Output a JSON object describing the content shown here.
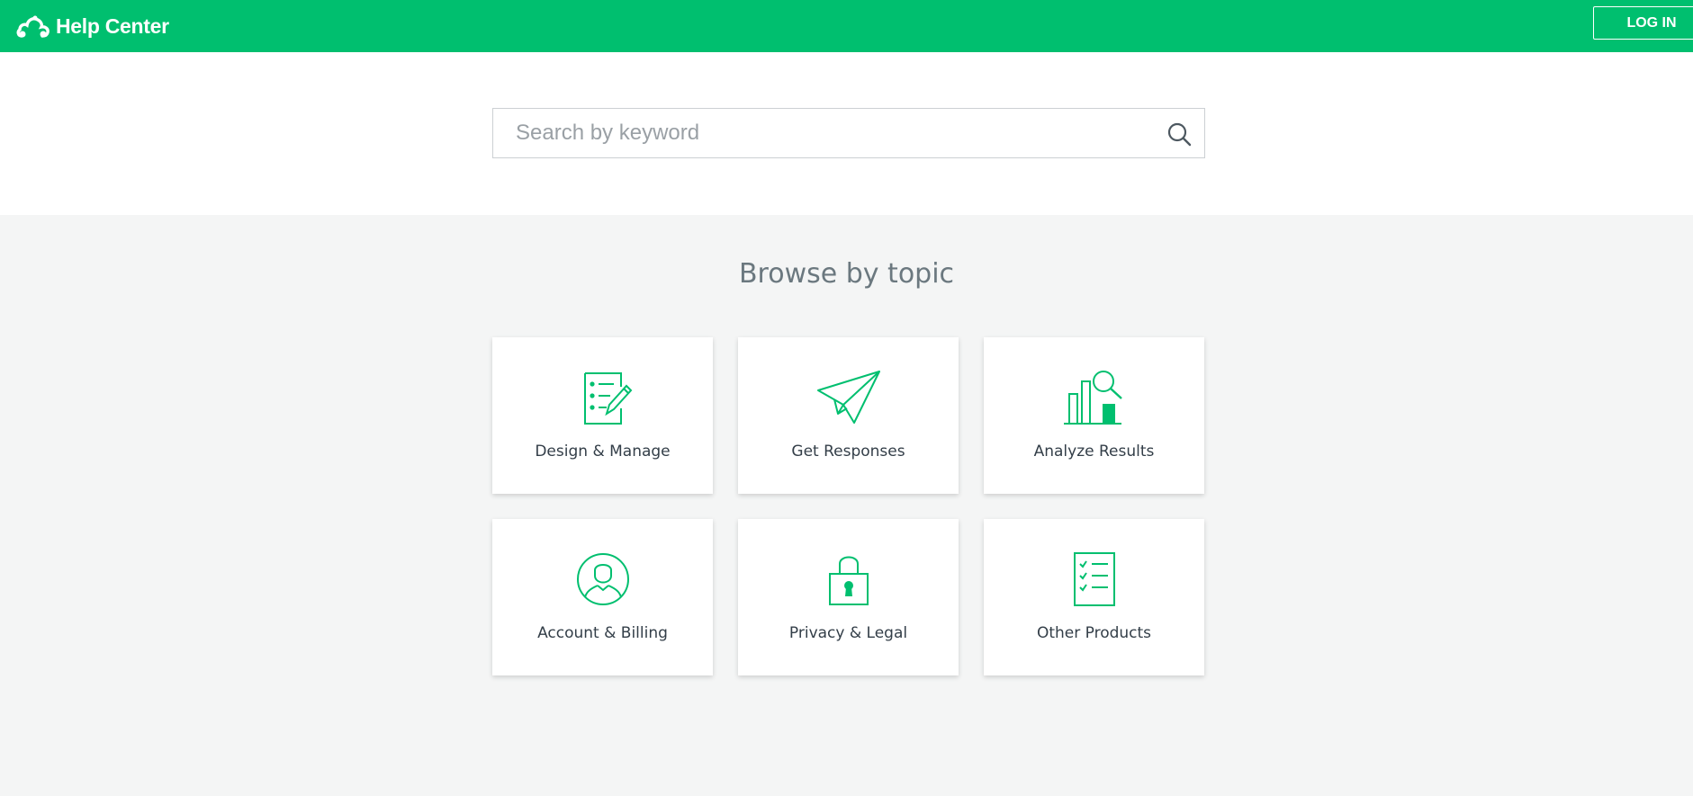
{
  "header": {
    "brand_title": "Help Center",
    "login_label": "LOG IN",
    "brand_color": "#00bf6f"
  },
  "search": {
    "placeholder": "Search by keyword",
    "value": ""
  },
  "browse": {
    "title": "Browse by topic",
    "topics": [
      {
        "label": "Design & Manage",
        "icon": "document-edit-icon"
      },
      {
        "label": "Get Responses",
        "icon": "paper-plane-icon"
      },
      {
        "label": "Analyze Results",
        "icon": "bar-chart-magnifier-icon"
      },
      {
        "label": "Account & Billing",
        "icon": "user-circle-icon"
      },
      {
        "label": "Privacy & Legal",
        "icon": "padlock-icon"
      },
      {
        "label": "Other Products",
        "icon": "checklist-icon"
      }
    ]
  },
  "colors": {
    "accent": "#00bf6f",
    "background": "#f4f5f5",
    "text": "#333e48"
  }
}
